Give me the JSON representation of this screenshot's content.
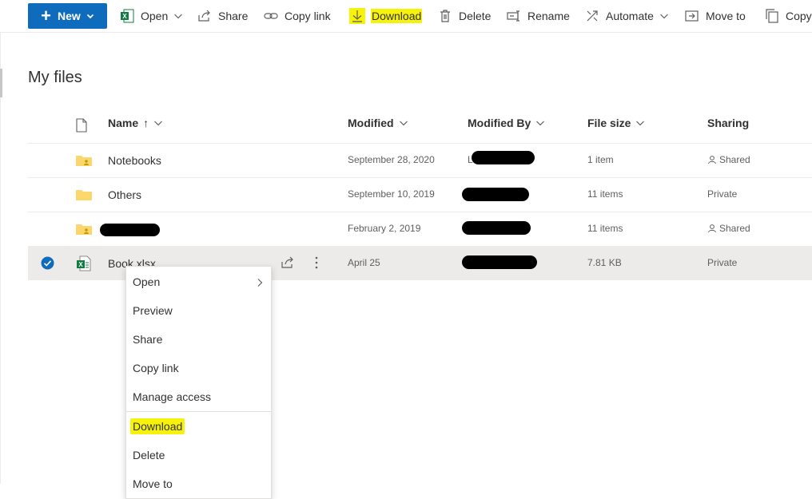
{
  "toolbar": {
    "new_label": "New",
    "open_label": "Open",
    "share_label": "Share",
    "copy_link_label": "Copy link",
    "download_label": "Download",
    "delete_label": "Delete",
    "rename_label": "Rename",
    "automate_label": "Automate",
    "move_to_label": "Move to",
    "copy_label": "Copy"
  },
  "page": {
    "title": "My files"
  },
  "list": {
    "columns": {
      "name": "Name",
      "name_sort": "↑",
      "modified": "Modified",
      "modified_by": "Modified By",
      "file_size": "File size",
      "sharing": "Sharing"
    },
    "rows": [
      {
        "name": "Notebooks",
        "icon": "shared-folder-icon",
        "modified": "September 28, 2020",
        "modified_by": "L",
        "file_size": "1 item",
        "sharing": "Shared",
        "redacted_by": true
      },
      {
        "name": "Others",
        "icon": "folder-icon",
        "modified": "September 10, 2019",
        "modified_by": "",
        "file_size": "11 items",
        "sharing": "Private",
        "redacted_by": true
      },
      {
        "name": "",
        "icon": "shared-folder-icon",
        "modified": "February 2, 2019",
        "modified_by": "",
        "file_size": "11 items",
        "sharing": "Shared",
        "redacted_name": true,
        "redacted_by": true
      },
      {
        "name": "Book.xlsx",
        "icon": "excel-file-icon",
        "modified": "April 25",
        "modified_by": "",
        "file_size": "7.81 KB",
        "sharing": "Private",
        "selected": true,
        "redacted_by": true
      }
    ]
  },
  "context_menu": {
    "items": [
      "Open",
      "Preview",
      "Share",
      "Copy link",
      "Manage access",
      "Download",
      "Delete",
      "Move to"
    ],
    "highlighted": "Download"
  },
  "colors": {
    "accent": "#0f6cbd",
    "highlight": "#f6f20a",
    "folder": "#f8d775",
    "excel": "#107c41",
    "selected_row": "#edebe9"
  }
}
